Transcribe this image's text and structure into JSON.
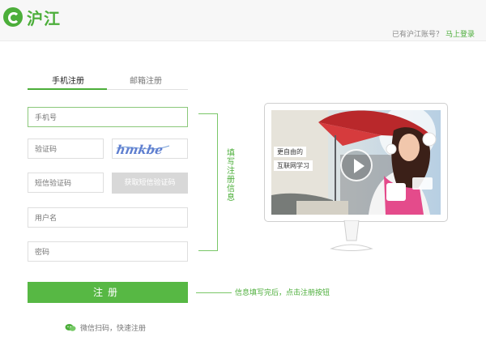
{
  "header": {
    "logo_text": "沪江",
    "account_prompt": "已有沪江账号？",
    "login_link": "马上登录"
  },
  "tabs": {
    "phone_register": "手机注册",
    "email_register": "邮箱注册"
  },
  "form": {
    "phone_placeholder": "手机号",
    "captcha_placeholder": "验证码",
    "captcha_text": "hmkbe",
    "sms_code_placeholder": "短信验证码",
    "get_sms_code_button": "获取短信验证码",
    "username_placeholder": "用户名",
    "password_placeholder": "密码",
    "register_button": "注册"
  },
  "wechat": {
    "label": "微信扫码，快速注册"
  },
  "callouts": {
    "fill_info": "填写注册信息",
    "click_register": "信息填写完后，点击注册按钮"
  },
  "video": {
    "line1": "更自由的",
    "line2": "互联网学习"
  },
  "colors": {
    "brand_green": "#4cae3a",
    "button_green": "#57b844",
    "disabled_gray": "#d8d8d8"
  }
}
